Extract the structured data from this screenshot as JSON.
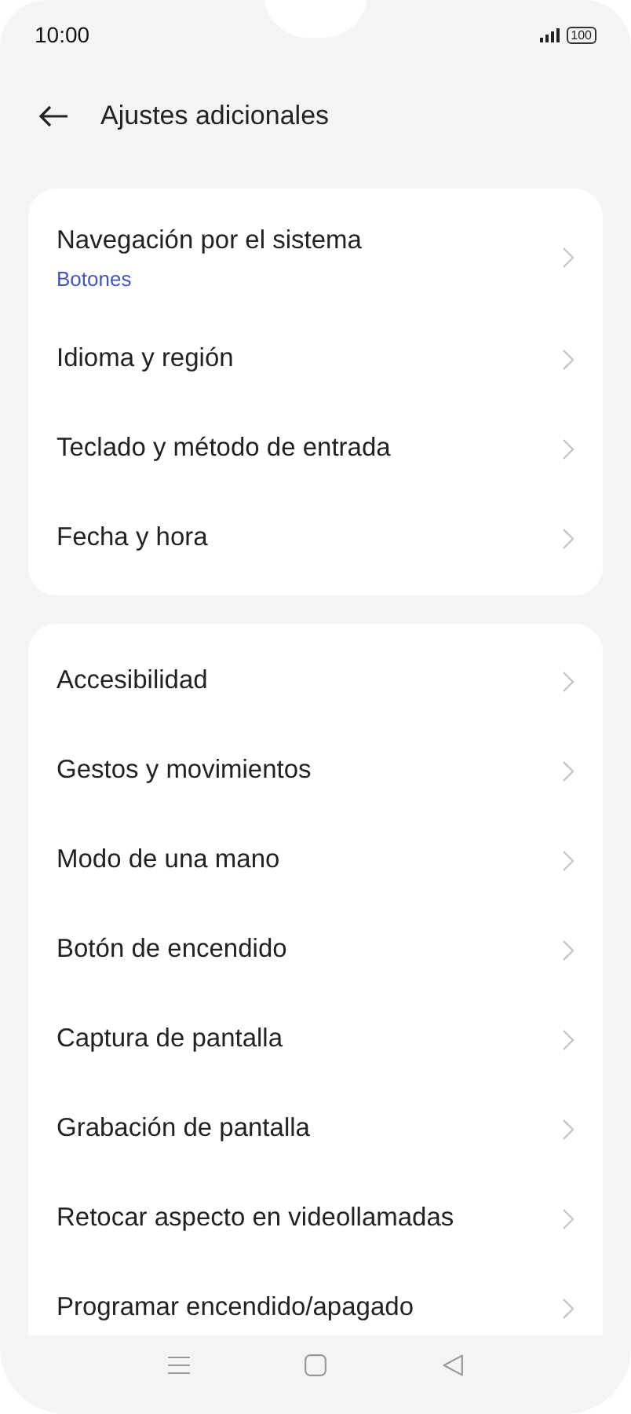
{
  "status_bar": {
    "time": "10:00",
    "battery": "100"
  },
  "header": {
    "title": "Ajustes adicionales"
  },
  "sections": [
    {
      "items": [
        {
          "label": "Navegación por el sistema",
          "value": "Botones"
        },
        {
          "label": "Idioma y región"
        },
        {
          "label": "Teclado y método de entrada"
        },
        {
          "label": "Fecha y hora"
        }
      ]
    },
    {
      "items": [
        {
          "label": "Accesibilidad"
        },
        {
          "label": "Gestos y movimientos"
        },
        {
          "label": "Modo de una mano"
        },
        {
          "label": "Botón de encendido"
        },
        {
          "label": "Captura de pantalla"
        },
        {
          "label": "Grabación de pantalla"
        },
        {
          "label": "Retocar aspecto en videollamadas"
        },
        {
          "label": "Programar encendido/apagado"
        }
      ]
    }
  ]
}
